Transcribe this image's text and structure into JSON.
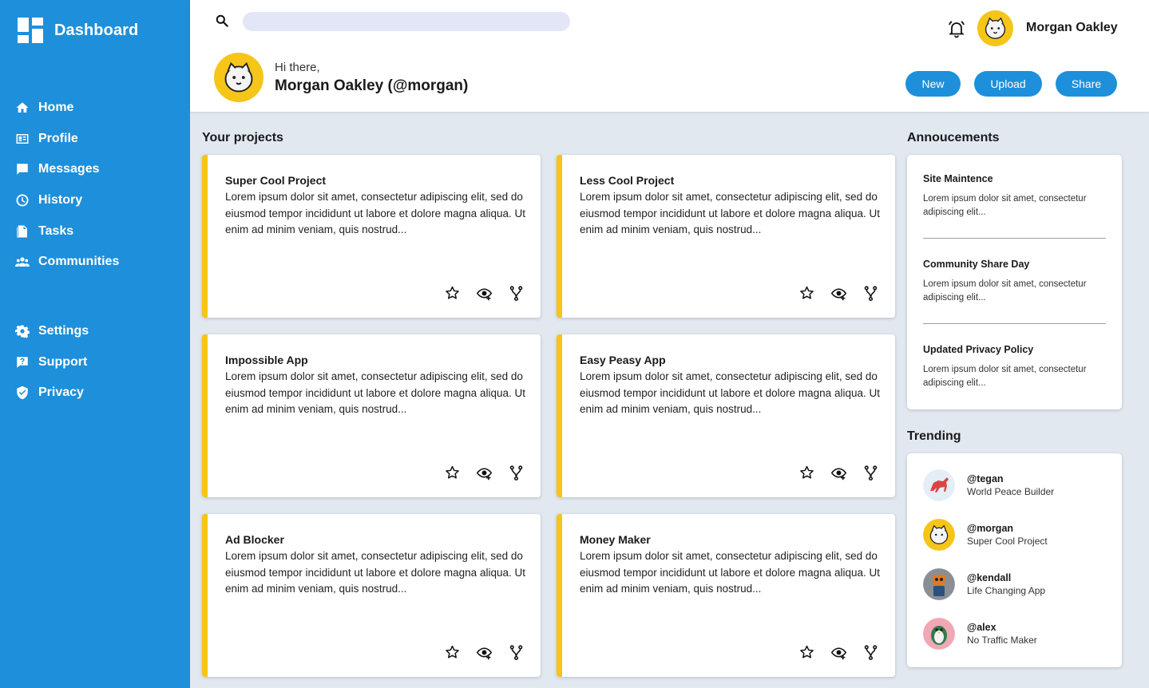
{
  "sidebar": {
    "title": "Dashboard",
    "items": [
      {
        "label": "Home",
        "icon": "home-icon"
      },
      {
        "label": "Profile",
        "icon": "profile-card-icon"
      },
      {
        "label": "Messages",
        "icon": "message-icon"
      },
      {
        "label": "History",
        "icon": "clock-icon"
      },
      {
        "label": "Tasks",
        "icon": "document-icon"
      },
      {
        "label": "Communities",
        "icon": "people-icon"
      }
    ],
    "secondary": [
      {
        "label": "Settings",
        "icon": "gear-icon"
      },
      {
        "label": "Support",
        "icon": "help-icon"
      },
      {
        "label": "Privacy",
        "icon": "shield-icon"
      }
    ]
  },
  "header": {
    "search_placeholder": "",
    "user_name": "Morgan Oakley",
    "greeting": "Hi there,",
    "handle": "Morgan Oakley (@morgan)",
    "buttons": {
      "new": "New",
      "upload": "Upload",
      "share": "Share"
    }
  },
  "projects": {
    "title": "Your projects",
    "items": [
      {
        "title": "Super Cool Project",
        "desc": "Lorem ipsum dolor sit amet, consectetur adipiscing elit, sed do eiusmod tempor incididunt ut labore et dolore magna aliqua. Ut enim ad minim veniam, quis nostrud..."
      },
      {
        "title": "Less Cool Project",
        "desc": "Lorem ipsum dolor sit amet, consectetur adipiscing elit, sed do eiusmod tempor incididunt ut labore et dolore magna aliqua. Ut enim ad minim veniam, quis nostrud..."
      },
      {
        "title": "Impossible App",
        "desc": "Lorem ipsum dolor sit amet, consectetur adipiscing elit, sed do eiusmod tempor incididunt ut labore et dolore magna aliqua. Ut enim ad minim veniam, quis nostrud..."
      },
      {
        "title": "Easy Peasy App",
        "desc": "Lorem ipsum dolor sit amet, consectetur adipiscing elit, sed do eiusmod tempor incididunt ut labore et dolore magna aliqua. Ut enim ad minim veniam, quis nostrud..."
      },
      {
        "title": "Ad Blocker",
        "desc": "Lorem ipsum dolor sit amet, consectetur adipiscing elit, sed do eiusmod tempor incididunt ut labore et dolore magna aliqua. Ut enim ad minim veniam, quis nostrud..."
      },
      {
        "title": "Money Maker",
        "desc": "Lorem ipsum dolor sit amet, consectetur adipiscing elit, sed do eiusmod tempor incididunt ut labore et dolore magna aliqua. Ut enim ad minim veniam, quis nostrud..."
      }
    ]
  },
  "announcements": {
    "title": "Annoucements",
    "items": [
      {
        "title": "Site Maintence",
        "body": "Lorem ipsum dolor sit amet, consectetur adipiscing elit..."
      },
      {
        "title": "Community Share Day",
        "body": "Lorem ipsum dolor sit amet, consectetur adipiscing elit..."
      },
      {
        "title": "Updated Privacy Policy",
        "body": "Lorem ipsum dolor sit amet, consectetur adipiscing elit..."
      }
    ]
  },
  "trending": {
    "title": "Trending",
    "items": [
      {
        "handle": "@tegan",
        "project": "World Peace Builder",
        "avatar_color": "#e4eef7"
      },
      {
        "handle": "@morgan",
        "project": "Super Cool Project",
        "avatar_color": "#f5c518"
      },
      {
        "handle": "@kendall",
        "project": "Life Changing App",
        "avatar_color": "#8a8f96"
      },
      {
        "handle": "@alex",
        "project": "No Traffic Maker",
        "avatar_color": "#f2a7b5"
      }
    ]
  },
  "colors": {
    "primary": "#1e8fdb",
    "accent": "#f5c518",
    "background": "#e2e8f0"
  }
}
